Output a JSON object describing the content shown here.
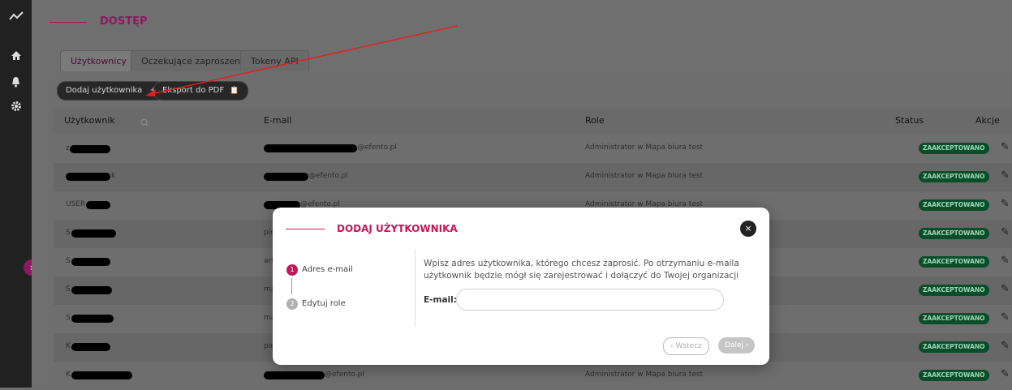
{
  "sidebar": {
    "icons": [
      "trend-icon",
      "home-icon",
      "bell-icon",
      "gear-icon"
    ],
    "toggle": "›"
  },
  "page": {
    "title": "DOSTĘP"
  },
  "tabs": [
    {
      "label": "Użytkownicy",
      "active": true
    },
    {
      "label": "Oczekujące zaproszenia",
      "active": false
    },
    {
      "label": "Tokeny API",
      "active": false
    }
  ],
  "toolbar": {
    "add_user": "Dodaj użytkownika",
    "add_icon": "+",
    "export_pdf": "Eksport do PDF",
    "export_icon": "📋"
  },
  "table": {
    "headers": {
      "user": "Użytkownik",
      "email": "E-mail",
      "role": "Role",
      "status": "Status",
      "actions": "Akcje"
    },
    "rows": [
      {
        "user": "z",
        "email": "@efento.pl",
        "role": "Administrator w Mapa biura test",
        "status": "ZAAKCEPTOWANO"
      },
      {
        "user": "k",
        "email": "@efento.pl",
        "role": "Administrator w Mapa biura test",
        "status": "ZAAKCEPTOWANO"
      },
      {
        "user": "USER",
        "email": "@efento.pl",
        "role": "Administrator w Mapa biura test",
        "status": "ZAAKCEPTOWANO"
      },
      {
        "user": "S",
        "email": "pio",
        "role": "",
        "status": "ZAAKCEPTOWANO"
      },
      {
        "user": "S",
        "email": "art",
        "role": "",
        "status": "ZAAKCEPTOWANO"
      },
      {
        "user": "Ś",
        "email": "ma",
        "role": "",
        "status": "ZAAKCEPTOWANO"
      },
      {
        "user": "S",
        "email": "ma",
        "role": "",
        "status": "ZAAKCEPTOWANO"
      },
      {
        "user": "K",
        "email": "pa",
        "role": "",
        "status": "ZAAKCEPTOWANO"
      },
      {
        "user": "K",
        "email": "@efento.pl",
        "role": "Administrator w Mapa biura test",
        "status": "ZAAKCEPTOWANO"
      }
    ]
  },
  "modal": {
    "title": "DODAJ UŻYTKOWNIKA",
    "close_icon": "×",
    "steps": [
      {
        "num": "1",
        "label": "Adres e-mail"
      },
      {
        "num": "2",
        "label": "Edytuj role"
      }
    ],
    "description": "Wpisz adres użytkownika, którego chcesz zaprosić. Po otrzymaniu e-maila użytkownik będzie mógł się zarejestrować i dołączyć do Twojej organizacji",
    "email_label": "E-mail:",
    "email_value": "",
    "back": "‹ Wstecz",
    "next": "Dalej ›"
  },
  "colors": {
    "accent": "#c2185b",
    "status_bg": "#0b4d2a",
    "annotation_arrow": "#e02020"
  }
}
